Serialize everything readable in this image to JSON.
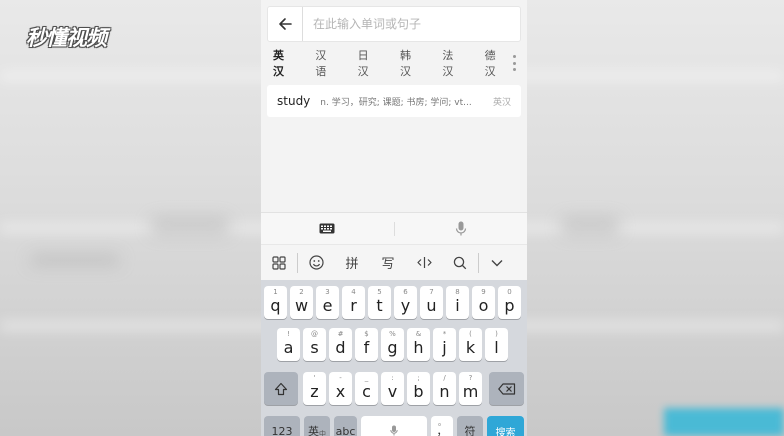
{
  "watermark": {
    "text": "秒懂视频"
  },
  "search": {
    "placeholder": "在此输入单词或句子",
    "value": ""
  },
  "lang_tabs": [
    {
      "label": "英汉",
      "active": true
    },
    {
      "label": "汉语",
      "active": false
    },
    {
      "label": "日汉",
      "active": false
    },
    {
      "label": "韩汉",
      "active": false
    },
    {
      "label": "法汉",
      "active": false
    },
    {
      "label": "德汉",
      "active": false
    }
  ],
  "result": {
    "word": "study",
    "definition": "n. 学习，研究; 课题; 书房; 学问; vt...",
    "tag": "英汉"
  },
  "keyboard": {
    "toolbar": {
      "pinyin": "拼",
      "handwrite": "写"
    },
    "row1": [
      {
        "main": "q",
        "sub": "1"
      },
      {
        "main": "w",
        "sub": "2"
      },
      {
        "main": "e",
        "sub": "3"
      },
      {
        "main": "r",
        "sub": "4"
      },
      {
        "main": "t",
        "sub": "5"
      },
      {
        "main": "y",
        "sub": "6"
      },
      {
        "main": "u",
        "sub": "7"
      },
      {
        "main": "i",
        "sub": "8"
      },
      {
        "main": "o",
        "sub": "9"
      },
      {
        "main": "p",
        "sub": "0"
      }
    ],
    "row2": [
      {
        "main": "a",
        "sub": "!"
      },
      {
        "main": "s",
        "sub": "@"
      },
      {
        "main": "d",
        "sub": "#"
      },
      {
        "main": "f",
        "sub": "$"
      },
      {
        "main": "g",
        "sub": "%"
      },
      {
        "main": "h",
        "sub": "&"
      },
      {
        "main": "j",
        "sub": "*"
      },
      {
        "main": "k",
        "sub": "("
      },
      {
        "main": "l",
        "sub": ")"
      }
    ],
    "row3": [
      {
        "main": "z",
        "sub": "'"
      },
      {
        "main": "x",
        "sub": "-"
      },
      {
        "main": "c",
        "sub": "_"
      },
      {
        "main": "v",
        "sub": ":"
      },
      {
        "main": "b",
        "sub": ";"
      },
      {
        "main": "n",
        "sub": "/"
      },
      {
        "main": "m",
        "sub": "?"
      }
    ],
    "bottom": {
      "num_label": "123",
      "lang_label": "英",
      "lang_sub": "中",
      "abc_label": "abc",
      "punct_label": "，",
      "punct_sub": "。",
      "symbol_label": "符",
      "search_label": "搜索"
    }
  },
  "colors": {
    "accent": "#2fa7d7",
    "key_bg": "#ffffff",
    "keyboard_bg": "#d5d8dd"
  }
}
